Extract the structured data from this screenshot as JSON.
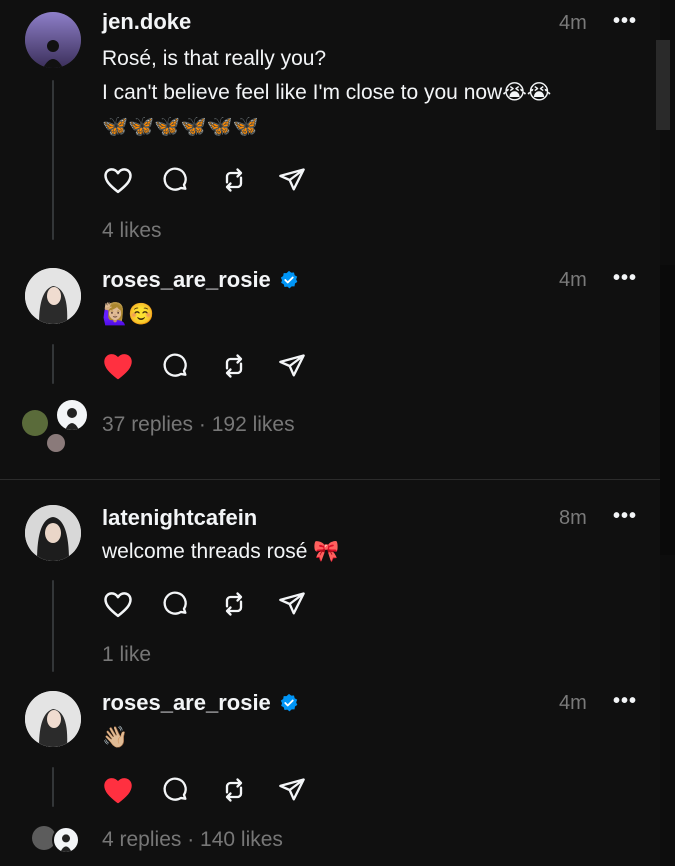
{
  "posts": [
    {
      "username": "jen.doke",
      "time": "4m",
      "more": "•••",
      "verified": false,
      "lines": [
        "Rosé, is that really you?",
        "I can't believe feel like I'm close to you now😭😭",
        "🦋🦋🦋🦋🦋🦋"
      ],
      "liked": false,
      "stats": "4 likes"
    },
    {
      "username": "roses_are_rosie",
      "time": "4m",
      "more": "•••",
      "verified": true,
      "lines": [
        "🙋🏼‍♀️☺️"
      ],
      "liked": true,
      "stats": "37 replies · 192 likes"
    },
    {
      "username": "latenightcafein",
      "time": "8m",
      "more": "•••",
      "verified": false,
      "lines": [
        "welcome threads rosé 🎀"
      ],
      "liked": false,
      "stats": "1 like"
    },
    {
      "username": "roses_are_rosie",
      "time": "4m",
      "more": "•••",
      "verified": true,
      "lines": [
        "👋🏼"
      ],
      "liked": true,
      "stats": "4 replies · 140 likes"
    }
  ],
  "colors": {
    "background": "#101010",
    "text": "#f3f5f7",
    "muted": "#777777",
    "like_red": "#ff3040",
    "verified_blue": "#0095f6"
  },
  "icons": [
    "heart-icon",
    "comment-icon",
    "repost-icon",
    "share-icon",
    "more-icon",
    "verified-icon"
  ]
}
